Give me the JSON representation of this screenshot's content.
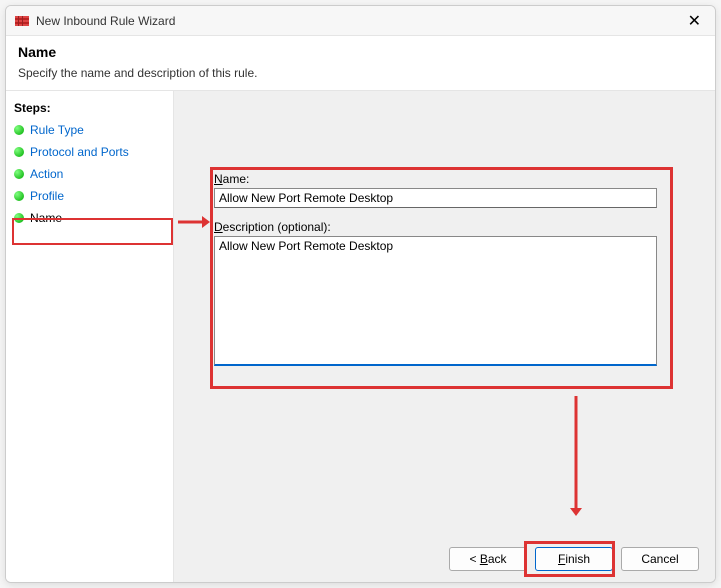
{
  "titlebar": {
    "title": "New Inbound Rule Wizard"
  },
  "header": {
    "title": "Name",
    "subtitle": "Specify the name and description of this rule."
  },
  "sidebar": {
    "title": "Steps:",
    "items": [
      {
        "label": "Rule Type"
      },
      {
        "label": "Protocol and Ports"
      },
      {
        "label": "Action"
      },
      {
        "label": "Profile"
      },
      {
        "label": "Name"
      }
    ]
  },
  "form": {
    "name_label_pre": "",
    "name_label_mn": "N",
    "name_label_post": "ame:",
    "name_value": "Allow New Port Remote Desktop",
    "desc_label_pre": "",
    "desc_label_mn": "D",
    "desc_label_post": "escription (optional):",
    "desc_value": "Allow New Port Remote Desktop"
  },
  "buttons": {
    "back_pre": "< ",
    "back_mn": "B",
    "back_post": "ack",
    "finish_pre": "",
    "finish_mn": "F",
    "finish_post": "inish",
    "cancel": "Cancel"
  }
}
